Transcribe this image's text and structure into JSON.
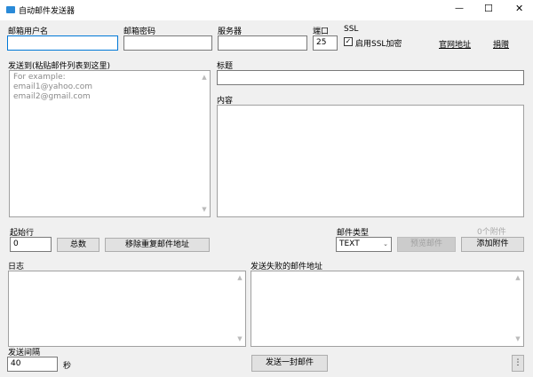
{
  "window": {
    "title": "自动邮件发送器",
    "minimize": "—",
    "maximize": "☐",
    "close": "✕"
  },
  "labels": {
    "username": "邮箱用户名",
    "password": "邮箱密码",
    "server": "服务器",
    "port": "端口",
    "ssl": "SSL",
    "send_to": "发送到(粘贴邮件列表到这里)",
    "subject": "标题",
    "content": "内容",
    "start_row": "起始行",
    "mail_type": "邮件类型",
    "attachments_count": "0个附件",
    "log": "日志",
    "failed": "发送失败的邮件地址",
    "interval": "发送间隔",
    "seconds": "秒"
  },
  "fields": {
    "username": "",
    "password": "",
    "server": "",
    "port": "25",
    "subject": "",
    "content": "",
    "start_row": "0",
    "interval": "40",
    "send_to_placeholder": "For example:\nemail1@yahoo.com\nemail2@gmail.com"
  },
  "ssl_checkbox": {
    "label": "启用SSL加密",
    "checked": true
  },
  "links": {
    "website": "官网地址",
    "donate": "捐赠"
  },
  "buttons": {
    "total": "总数",
    "remove_dup": "移除重复邮件地址",
    "preview": "预览邮件",
    "add_attachment": "添加附件",
    "send_one": "发送一封邮件",
    "extra": "⋮"
  },
  "mail_type": {
    "selected": "TEXT"
  }
}
